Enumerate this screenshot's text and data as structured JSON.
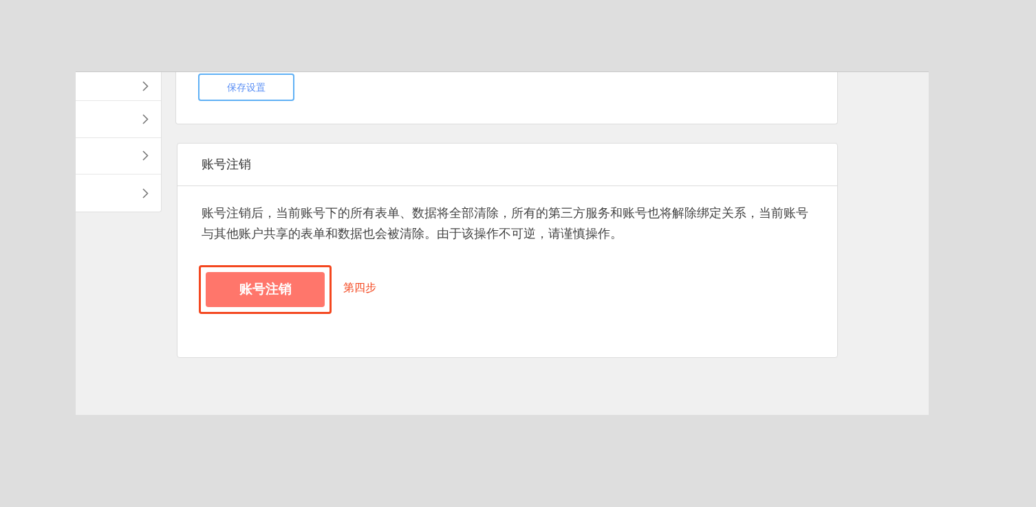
{
  "settings_card": {
    "save_button": "保存设置"
  },
  "deactivate_card": {
    "title": "账号注销",
    "description": "账号注销后，当前账号下的所有表单、数据将全部清除，所有的第三方服务和账号也将解除绑定关系，当前账号与其他账户共享的表单和数据也会被清除。由于该操作不可逆，请谨慎操作。",
    "button": "账号注销"
  },
  "annotation": {
    "label": "第四步"
  }
}
